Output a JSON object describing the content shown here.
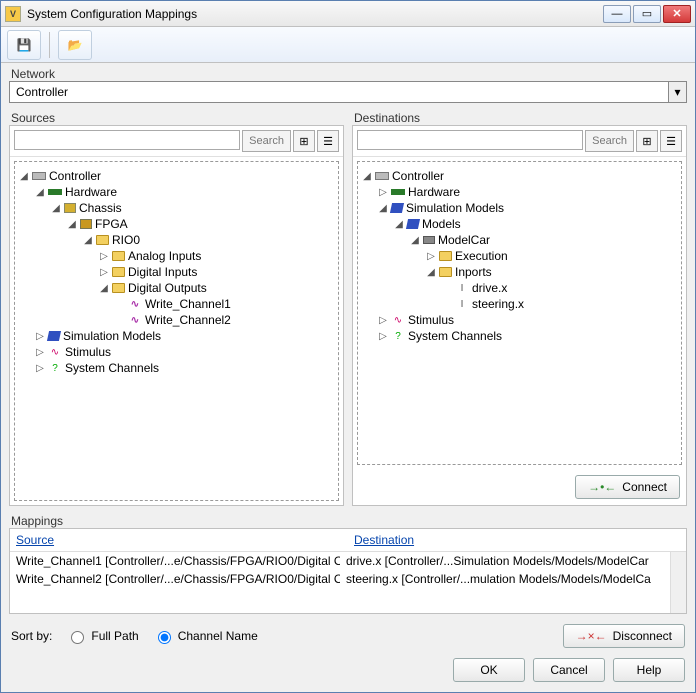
{
  "window": {
    "title": "System Configuration Mappings"
  },
  "toolbar": {
    "save_icon": "save-icon",
    "open_icon": "open-folder-icon"
  },
  "network": {
    "label": "Network",
    "value": "Controller"
  },
  "sources": {
    "label": "Sources",
    "search_placeholder": "",
    "search_button": "Search",
    "tree": {
      "root": "Controller",
      "hardware": "Hardware",
      "chassis": "Chassis",
      "fpga": "FPGA",
      "rio0": "RIO0",
      "analog_inputs": "Analog Inputs",
      "digital_inputs": "Digital Inputs",
      "digital_outputs": "Digital Outputs",
      "write_channel1": "Write_Channel1",
      "write_channel2": "Write_Channel2",
      "simulation_models": "Simulation Models",
      "stimulus": "Stimulus",
      "system_channels": "System Channels"
    }
  },
  "destinations": {
    "label": "Destinations",
    "search_placeholder": "",
    "search_button": "Search",
    "connect_button": "Connect",
    "tree": {
      "root": "Controller",
      "hardware": "Hardware",
      "simulation_models": "Simulation Models",
      "models": "Models",
      "modelcar": "ModelCar",
      "execution": "Execution",
      "inports": "Inports",
      "drive_x": "drive.x",
      "steering_x": "steering.x",
      "stimulus": "Stimulus",
      "system_channels": "System Channels"
    }
  },
  "mappings": {
    "label": "Mappings",
    "col_source": "Source",
    "col_destination": "Destination",
    "rows": [
      {
        "source": "Write_Channel1 [Controller/...e/Chassis/FPGA/RIO0/Digital O",
        "destination": "drive.x [Controller/...Simulation Models/Models/ModelCar"
      },
      {
        "source": "Write_Channel2 [Controller/...e/Chassis/FPGA/RIO0/Digital O",
        "destination": "steering.x [Controller/...mulation Models/Models/ModelCa"
      }
    ]
  },
  "sort": {
    "label": "Sort by:",
    "full_path": "Full Path",
    "channel_name": "Channel Name",
    "selected": "channel_name"
  },
  "buttons": {
    "disconnect": "Disconnect",
    "ok": "OK",
    "cancel": "Cancel",
    "help": "Help"
  }
}
